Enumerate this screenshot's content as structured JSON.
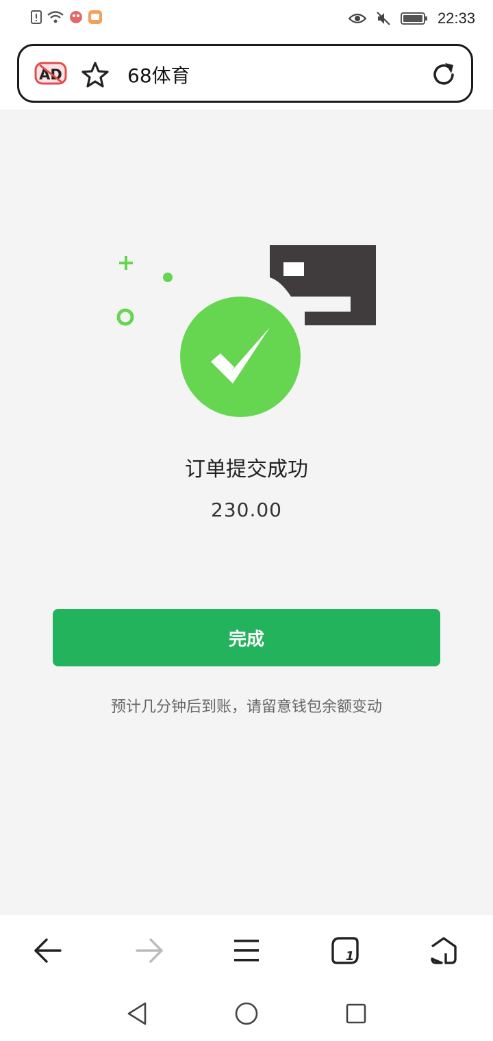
{
  "status_bar": {
    "time": "22:33"
  },
  "address_bar": {
    "title": "68体育",
    "icons": [
      "ad-block-icon",
      "star-icon",
      "refresh-icon"
    ]
  },
  "result": {
    "title": "订单提交成功",
    "amount": "230.00",
    "done_label": "完成",
    "note": "预计几分钟后到账，请留意钱包余额变动"
  },
  "colors": {
    "accent_green": "#22b35c",
    "check_green": "#66d651",
    "card_dark": "#403c3d"
  },
  "browser_toolbar": {
    "icons": [
      "back-icon",
      "forward-icon",
      "menu-icon",
      "tabs-icon",
      "home-icon"
    ],
    "tab_count": "1"
  },
  "system_nav": {
    "icons": [
      "nav-back-icon",
      "nav-home-icon",
      "nav-recents-icon"
    ]
  }
}
